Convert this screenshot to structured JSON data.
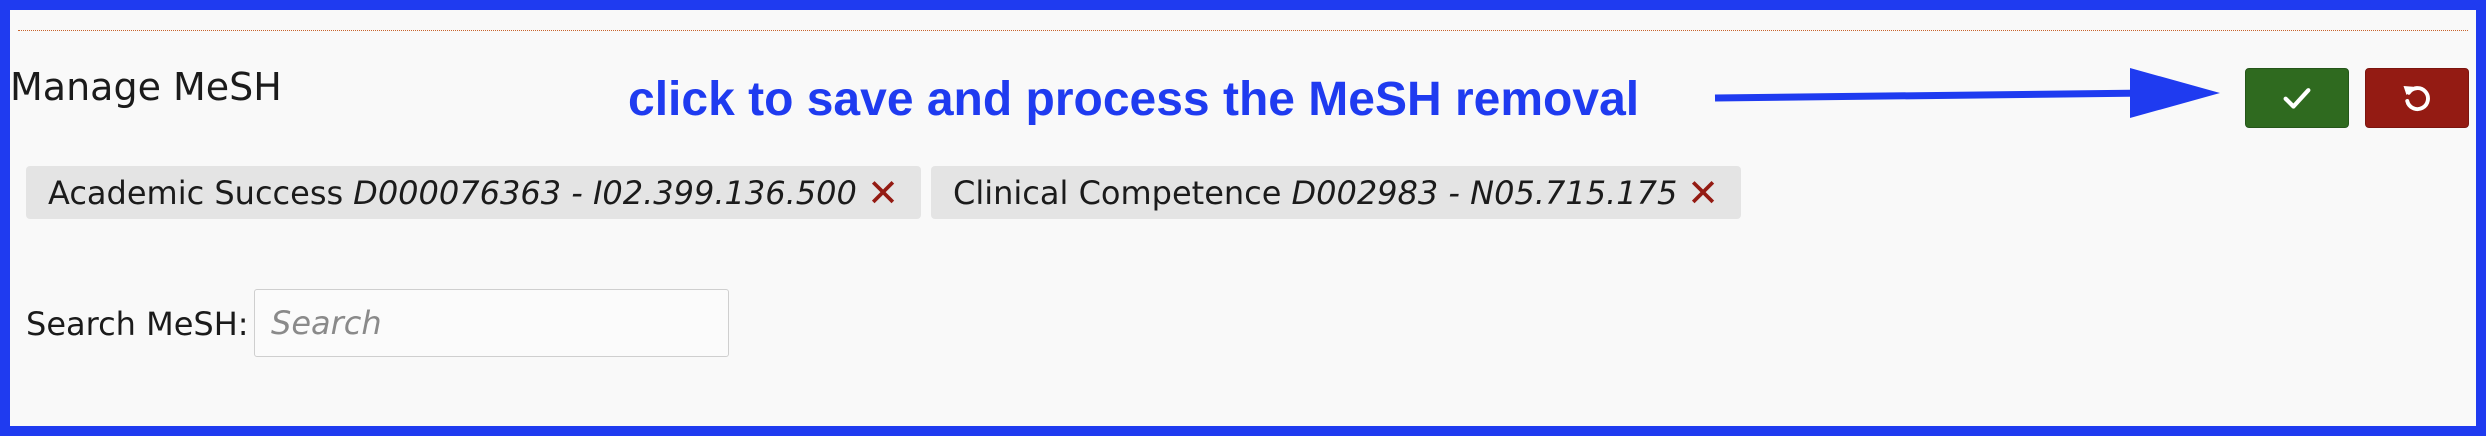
{
  "header": {
    "title": "Manage MeSH"
  },
  "annotation": {
    "text": "click to save and process the MeSH removal",
    "color": "#1f3bf0"
  },
  "actions": {
    "save_icon": "check-icon",
    "undo_icon": "undo-icon",
    "save_color": "#2f6a1f",
    "undo_color": "#941b13"
  },
  "selected_terms": [
    {
      "name": "Academic Success",
      "code": "D000076363 - I02.399.136.500",
      "remove_glyph": "✕"
    },
    {
      "name": "Clinical Competence",
      "code": "D002983 - N05.715.175",
      "remove_glyph": "✕"
    }
  ],
  "search": {
    "label": "Search MeSH:",
    "placeholder": "Search",
    "value": ""
  }
}
